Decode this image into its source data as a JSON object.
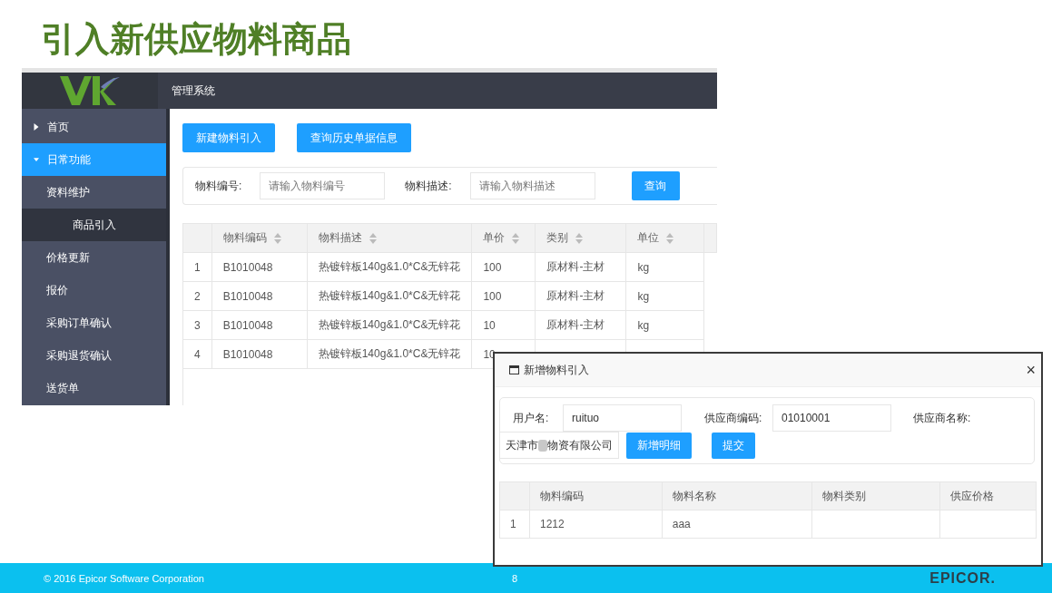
{
  "slide_title": "引入新供应物料商品",
  "app": {
    "header_title": "管理系统",
    "sidebar": [
      {
        "label": "首页",
        "kind": "group",
        "expanded": false,
        "selected": false
      },
      {
        "label": "日常功能",
        "kind": "group",
        "expanded": true,
        "selected": true
      },
      {
        "label": "资料维护",
        "kind": "item",
        "selected": false
      },
      {
        "label": "商品引入",
        "kind": "subitem",
        "selected": true
      },
      {
        "label": "价格更新",
        "kind": "item",
        "selected": false
      },
      {
        "label": "报价",
        "kind": "item",
        "selected": false
      },
      {
        "label": "采购订单确认",
        "kind": "item",
        "selected": false
      },
      {
        "label": "采购退货确认",
        "kind": "item",
        "selected": false
      },
      {
        "label": "送货单",
        "kind": "item",
        "selected": false
      }
    ],
    "actions": [
      "新建物料引入",
      "查询历史单据信息"
    ],
    "filters": [
      {
        "label": "物料编号:",
        "placeholder": "请输入物料编号"
      },
      {
        "label": "物料描述:",
        "placeholder": "请输入物料描述"
      }
    ],
    "search_button": "查询",
    "table": {
      "columns": [
        "",
        "物料编码",
        "物料描述",
        "单价",
        "类别",
        "单位"
      ],
      "rows": [
        [
          "1",
          "B1010048",
          "热镀锌板140g&1.0*C&无锌花",
          "100",
          "原材料-主材",
          "kg"
        ],
        [
          "2",
          "B1010048",
          "热镀锌板140g&1.0*C&无锌花",
          "100",
          "原材料-主材",
          "kg"
        ],
        [
          "3",
          "B1010048",
          "热镀锌板140g&1.0*C&无锌花",
          "10",
          "原材料-主材",
          "kg"
        ],
        [
          "4",
          "B1010048",
          "热镀锌板140g&1.0*C&无锌花",
          "10"
        ]
      ]
    }
  },
  "dialog": {
    "title": "新增物料引入",
    "close": "×",
    "fields": [
      {
        "label": "用户名:",
        "value": "ruituo"
      },
      {
        "label": "供应商编码:",
        "value": "01010001"
      },
      {
        "label": "供应商名称:",
        "value_before": "天津市",
        "value_after": "物资有限公司",
        "redacted": true
      }
    ],
    "buttons": [
      "新增明细",
      "提交"
    ],
    "table": {
      "columns": [
        "",
        "物料编码",
        "物料名称",
        "物料类别",
        "供应价格"
      ],
      "rows": [
        [
          "1",
          "1212",
          "aaa",
          "",
          ""
        ]
      ]
    }
  },
  "footer": {
    "copyright": "© 2016 Epicor Software Corporation",
    "page": "8",
    "logo": "EPICOR."
  }
}
